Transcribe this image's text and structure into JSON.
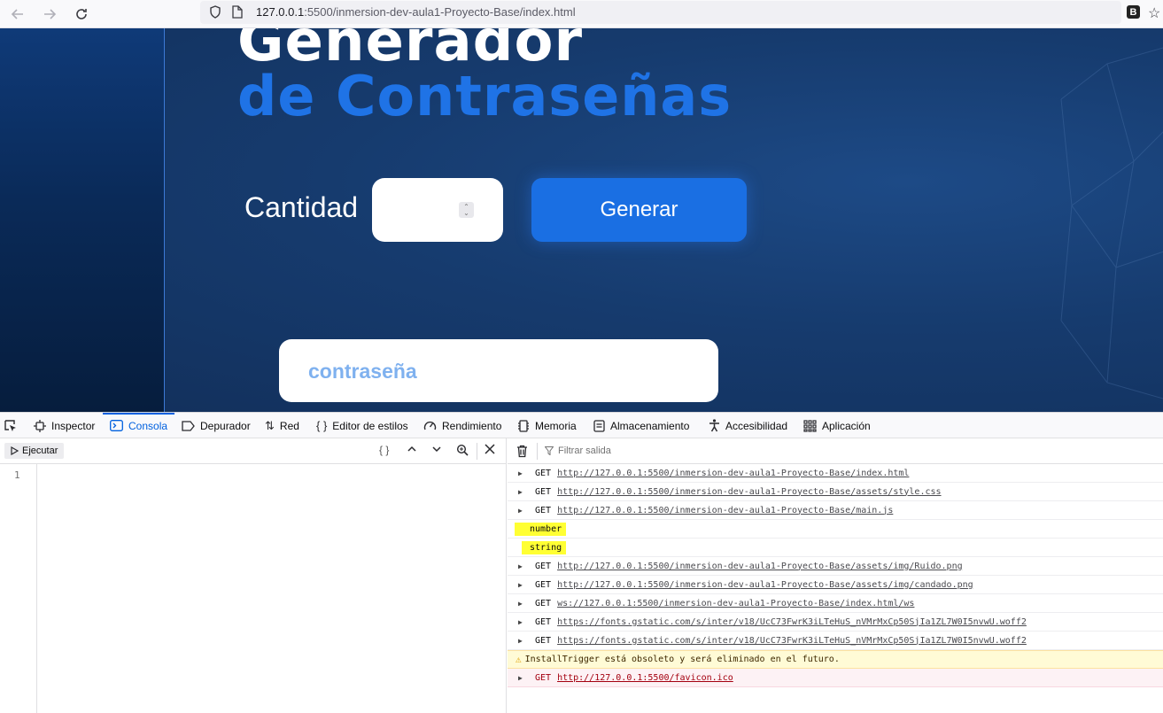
{
  "browser": {
    "url_host": "127.0.0.1",
    "url_rest": ":5500/inmersion-dev-aula1-Proyecto-Base/index.html",
    "extension_letter": "B"
  },
  "page": {
    "title_line1": "Generador",
    "title_line2": "de Contraseñas",
    "quantity_label": "Cantidad",
    "quantity_value": "",
    "generate_button": "Generar",
    "password_output": "contraseña",
    "colors": {
      "title_accent": "#1f73e6",
      "button": "#1a6fe3",
      "password_text": "#7fb1ef"
    }
  },
  "devtools": {
    "tabs": [
      {
        "label": "Inspector",
        "icon": "inspector-icon"
      },
      {
        "label": "Consola",
        "icon": "console-icon",
        "selected": true
      },
      {
        "label": "Depurador",
        "icon": "debugger-icon"
      },
      {
        "label": "Red",
        "icon": "network-icon"
      },
      {
        "label": "Editor de estilos",
        "icon": "style-editor-icon"
      },
      {
        "label": "Rendimiento",
        "icon": "performance-icon"
      },
      {
        "label": "Memoria",
        "icon": "memory-icon"
      },
      {
        "label": "Almacenamiento",
        "icon": "storage-icon"
      },
      {
        "label": "Accesibilidad",
        "icon": "accessibility-icon"
      },
      {
        "label": "Aplicación",
        "icon": "application-icon"
      }
    ],
    "editor": {
      "run_label": "Ejecutar",
      "line_number": "1"
    },
    "output": {
      "filter_placeholder": "Filtrar salida",
      "rows": [
        {
          "type": "net",
          "method": "GET",
          "url": "http://127.0.0.1:5500/inmersion-dev-aula1-Proyecto-Base/index.html"
        },
        {
          "type": "net",
          "method": "GET",
          "url": "http://127.0.0.1:5500/inmersion-dev-aula1-Proyecto-Base/assets/style.css"
        },
        {
          "type": "net",
          "method": "GET",
          "url": "http://127.0.0.1:5500/inmersion-dev-aula1-Proyecto-Base/main.js"
        },
        {
          "type": "log",
          "text": "number"
        },
        {
          "type": "log",
          "text": "string"
        },
        {
          "type": "net",
          "method": "GET",
          "url": "http://127.0.0.1:5500/inmersion-dev-aula1-Proyecto-Base/assets/img/Ruido.png"
        },
        {
          "type": "net",
          "method": "GET",
          "url": "http://127.0.0.1:5500/inmersion-dev-aula1-Proyecto-Base/assets/img/candado.png"
        },
        {
          "type": "net",
          "method": "GET",
          "url": "ws://127.0.0.1:5500/inmersion-dev-aula1-Proyecto-Base/index.html/ws"
        },
        {
          "type": "net",
          "method": "GET",
          "url": "https://fonts.gstatic.com/s/inter/v18/UcC73FwrK3iLTeHuS_nVMrMxCp50SjIa1ZL7W0I5nvwU.woff2"
        },
        {
          "type": "net",
          "method": "GET",
          "url": "https://fonts.gstatic.com/s/inter/v18/UcC73FwrK3iLTeHuS_nVMrMxCp50SjIa1ZL7W0I5nvwU.woff2"
        },
        {
          "type": "warn",
          "text": "InstallTrigger está obsoleto y será eliminado en el futuro."
        },
        {
          "type": "err",
          "method": "GET",
          "url": "http://127.0.0.1:5500/favicon.ico"
        }
      ]
    }
  }
}
